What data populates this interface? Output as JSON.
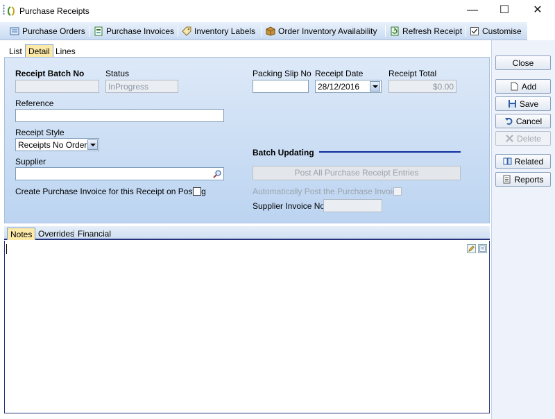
{
  "window": {
    "title": "Purchase Receipts",
    "minimize": "—",
    "maximize": "☐",
    "close": "✕"
  },
  "toolbar": {
    "purchase_orders": "Purchase Orders",
    "purchase_invoices": "Purchase Invoices",
    "inventory_labels": "Inventory Labels",
    "order_inventory_availability": "Order Inventory Availability",
    "refresh_receipt": "Refresh Receipt",
    "customise": "Customise"
  },
  "tabs": {
    "list": "List",
    "detail": "Detail",
    "lines": "Lines"
  },
  "form": {
    "receipt_batch_no_label": "Receipt Batch No",
    "receipt_batch_no_value": "",
    "status_label": "Status",
    "status_value": "InProgress",
    "packing_slip_no_label": "Packing Slip No",
    "packing_slip_no_value": "",
    "receipt_date_label": "Receipt Date",
    "receipt_date_value": "28/12/2016",
    "receipt_total_label": "Receipt Total",
    "receipt_total_value": "$0.00",
    "reference_label": "Reference",
    "reference_value": "",
    "receipt_style_label": "Receipt Style",
    "receipt_style_value": "Receipts No Order",
    "supplier_label": "Supplier",
    "supplier_value": "",
    "create_invoice_label": "Create Purchase Invoice for this Receipt on Posting",
    "batch_updating_label": "Batch Updating",
    "post_all_label": "Post All Purchase Receipt Entries",
    "auto_post_label": "Automatically Post the Purchase Invoice",
    "supplier_invoice_no_label": "Supplier Invoice No",
    "supplier_invoice_no_value": ""
  },
  "bottom_tabs": {
    "notes": "Notes",
    "overrides": "Overrides",
    "financial": "Financial"
  },
  "buttons": {
    "close": "Close",
    "add": "Add",
    "save": "Save",
    "cancel": "Cancel",
    "delete": "Delete",
    "related": "Related",
    "reports": "Reports"
  },
  "colors": {
    "accent": "#0a2c9c",
    "tab_active": "#fde9a8",
    "panel_top": "#dde9f8",
    "panel_bottom": "#bcd4f1"
  }
}
